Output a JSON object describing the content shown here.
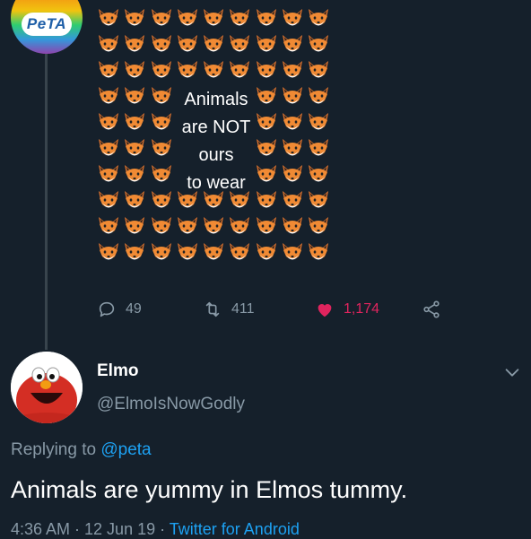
{
  "original_tweet": {
    "avatar_logo_text": "PeTA",
    "image_text_lines": [
      "Animals",
      "are NOT",
      "ours",
      "to wear"
    ],
    "image_emoji": "fox-face-icon",
    "actions": {
      "replies": "49",
      "retweets": "411",
      "likes": "1,174"
    },
    "colors": {
      "like": "#e0245e",
      "muted": "#8899a6"
    }
  },
  "reply_tweet": {
    "author_name": "Elmo",
    "author_handle": "@ElmoIsNowGodly",
    "replying_prefix": "Replying to",
    "replying_mention": "@peta",
    "text": "Animals are yummy in Elmos tummy.",
    "timestamp": "4:36 AM · 12 Jun 19 · ",
    "source": "Twitter for Android"
  },
  "theme": {
    "background": "#15202b",
    "link": "#1da1f2",
    "text": "#ffffff"
  }
}
